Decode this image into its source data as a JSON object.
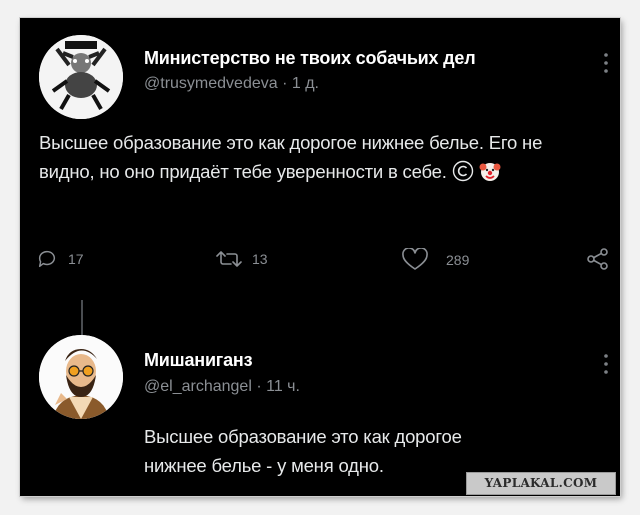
{
  "tweet1": {
    "display_name": "Министерство не твоих собачьих дел",
    "handle": "@trusymedvedeva",
    "time": "· 1 д.",
    "text": "Высшее образование это как дорогое нижнее белье. Его не видно, но оно придаёт тебе уверенности в себе.",
    "actions": {
      "reply_count": "17",
      "retweet_count": "13",
      "like_count": "289"
    }
  },
  "tweet2": {
    "display_name": "Мишаниганз",
    "handle": "@el_archangel",
    "time": "· 11 ч.",
    "text": "Высшее образование это как дорогое нижнее белье - у меня одно."
  },
  "watermark": "YAPLAKAL.COM",
  "icons": [
    "more-icon",
    "copyright-icon",
    "clown-emoji-icon",
    "reply-icon",
    "retweet-icon",
    "like-icon",
    "share-icon"
  ],
  "colors": {
    "background": "#000000",
    "text": "#e7e9ea",
    "secondary": "#8b8f94"
  }
}
